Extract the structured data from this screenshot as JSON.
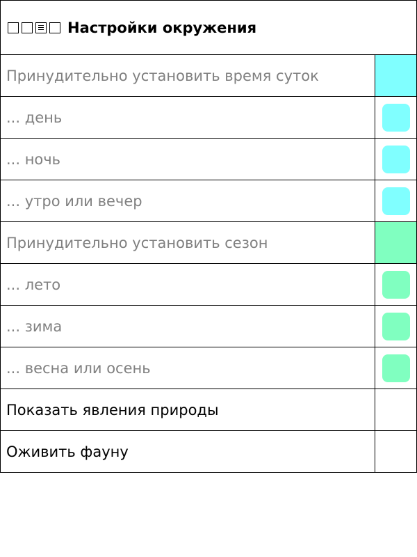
{
  "header": {
    "title": "Настройки окружения",
    "icons": [
      "square-icon",
      "square-icon",
      "list-icon",
      "square-icon"
    ]
  },
  "colors": {
    "time_accent": "#80ffff",
    "season_accent": "#80ffc0",
    "disabled_text": "#808080"
  },
  "rows": [
    {
      "label": "Принудительно установить время суток"
    },
    {
      "label": "... день"
    },
    {
      "label": "... ночь"
    },
    {
      "label": "... утро или вечер"
    },
    {
      "label": "Принудительно установить сезон"
    },
    {
      "label": "... лето"
    },
    {
      "label": "... зима"
    },
    {
      "label": "... весна или осень"
    },
    {
      "label": "Показать явления природы"
    },
    {
      "label": "Оживить фауну"
    }
  ]
}
